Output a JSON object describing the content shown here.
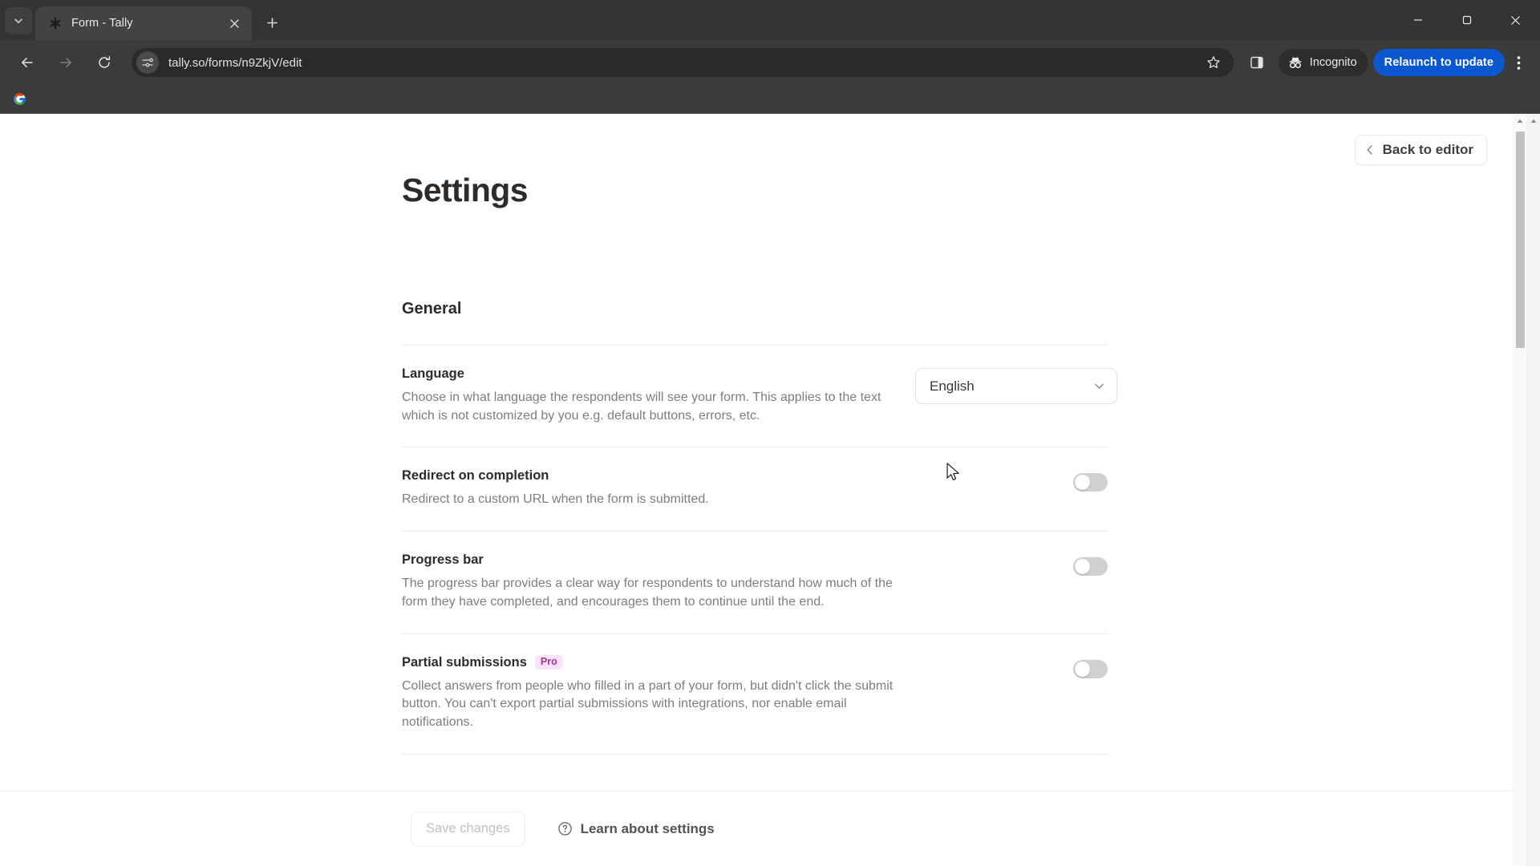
{
  "browser": {
    "tab": {
      "title": "Form - Tally",
      "favicon": "tally-asterisk-icon",
      "close_label": "×"
    },
    "new_tab_label": "+",
    "url": "tally.so/forms/n9ZkjV/edit",
    "profile_label": "Incognito",
    "relaunch_label": "Relaunch to update",
    "window_controls": {
      "minimize": "minimize-icon",
      "maximize": "restore-icon",
      "close": "close-icon"
    },
    "bookmarks": [
      {
        "name": "Google",
        "icon": "google-icon"
      }
    ]
  },
  "page": {
    "back_to_editor": "Back to editor",
    "title": "Settings",
    "section": {
      "heading": "General",
      "settings": [
        {
          "label": "Language",
          "badge": null,
          "description": "Choose in what language the respondents will see your form. This applies to the text which is not customized by you e.g. default buttons, errors, etc.",
          "control": "select",
          "value": "English"
        },
        {
          "label": "Redirect on completion",
          "badge": null,
          "description": "Redirect to a custom URL when the form is submitted.",
          "control": "toggle",
          "value": "off"
        },
        {
          "label": "Progress bar",
          "badge": null,
          "description": "The progress bar provides a clear way for respondents to understand how much of the form they have completed, and encourages them to continue until the end.",
          "control": "toggle",
          "value": "off"
        },
        {
          "label": "Partial submissions",
          "badge": "Pro",
          "description": "Collect answers from people who filled in a part of your form, but didn't click the submit button. You can't export partial submissions with integrations, nor enable email notifications.",
          "control": "toggle",
          "value": "off"
        }
      ]
    },
    "footer": {
      "save_label": "Save changes",
      "save_disabled": true,
      "learn_label": "Learn about settings",
      "learn_icon": "question-circle-icon"
    }
  },
  "colors": {
    "accent_blue": "#0b57d0",
    "pro_badge_bg": "#fbe2fa",
    "pro_badge_fg": "#9c3b95",
    "chrome_bg": "#3b3b3b",
    "tab_active": "#434343"
  }
}
